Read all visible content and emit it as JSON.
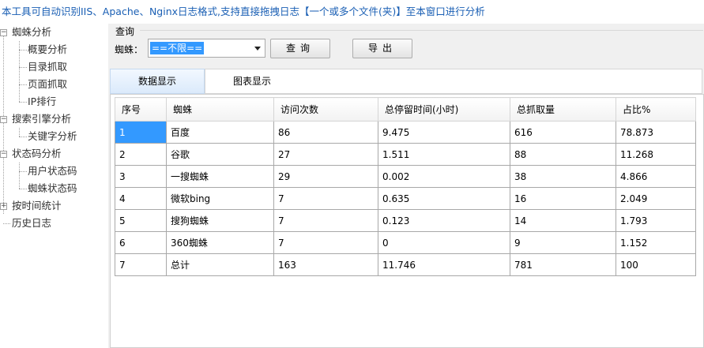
{
  "banner": "本工具可自动识别IIS、Apache、Nginx日志格式,支持直接拖拽日志【一个或多个文件(夹)】至本窗口进行分析",
  "tree": {
    "spider": {
      "label": "蜘蛛分析",
      "children": [
        "概要分析",
        "目录抓取",
        "页面抓取",
        "IP排行"
      ]
    },
    "engine": {
      "label": "搜索引擎分析",
      "children": [
        "关键字分析"
      ]
    },
    "status": {
      "label": "状态码分析",
      "children": [
        "用户状态码",
        "蜘蛛状态码"
      ]
    },
    "time": {
      "label": "按时间统计"
    },
    "history": {
      "label": "历史日志"
    }
  },
  "query": {
    "group_title": "查询",
    "spider_label": "蜘蛛：",
    "spider_value": "==不限==",
    "query_button": "查询",
    "export_button": "导出"
  },
  "tabs": {
    "data": "数据显示",
    "chart": "图表显示"
  },
  "table": {
    "headers": [
      "序号",
      "蜘蛛",
      "访问次数",
      "总停留时间(小时)",
      "总抓取量",
      "占比%"
    ],
    "rows": [
      [
        "1",
        "百度",
        "86",
        "9.475",
        "616",
        "78.873"
      ],
      [
        "2",
        "谷歌",
        "27",
        "1.511",
        "88",
        "11.268"
      ],
      [
        "3",
        "一搜蜘蛛",
        "29",
        "0.002",
        "38",
        "4.866"
      ],
      [
        "4",
        "微软bing",
        "7",
        "0.635",
        "16",
        "2.049"
      ],
      [
        "5",
        "搜狗蜘蛛",
        "7",
        "0.123",
        "14",
        "1.793"
      ],
      [
        "6",
        "360蜘蛛",
        "7",
        "0",
        "9",
        "1.152"
      ],
      [
        "7",
        "总计",
        "163",
        "11.746",
        "781",
        "100"
      ]
    ]
  },
  "colors": {
    "banner": "#1a5fb4",
    "selection": "#3399ff"
  }
}
